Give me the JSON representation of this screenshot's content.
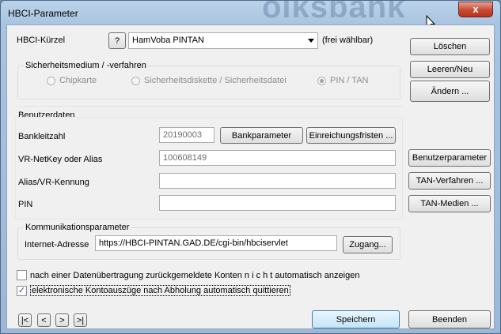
{
  "window": {
    "title": "HBCI-Parameter",
    "watermark": "olksbank",
    "close_glyph": "x"
  },
  "hbci_kuerzel": {
    "label": "HBCI-Kürzel",
    "help_label": "?",
    "value": "HamVoba PINTAN",
    "hint": "(frei wählbar)"
  },
  "security": {
    "title": "Sicherheitsmedium / -verfahren",
    "options": [
      "Chipkarte",
      "Sicherheitsdiskette / Sicherheitsdatei",
      "PIN / TAN"
    ],
    "selected": "PIN / TAN"
  },
  "user_data": {
    "title": "Benutzerdaten",
    "bankleitzahl_label": "Bankleitzahl",
    "bankleitzahl_value": "20190003",
    "bankparameter_button": "Bankparameter",
    "einreichungsfristen_button": "Einreichungsfristen ...",
    "netkey_label": "VR-NetKey oder Alias",
    "netkey_value": "100608149",
    "alias_label": "Alias/VR-Kennung",
    "alias_value": "",
    "pin_label": "PIN",
    "pin_value": ""
  },
  "communication": {
    "title": "Kommunikationsparameter",
    "address_label": "Internet-Adresse",
    "address_value": "https://HBCI-PINTAN.GAD.DE/cgi-bin/hbciservlet",
    "zugang_button": "Zugang..."
  },
  "options": {
    "unreported_accounts_label": "nach einer Datenübertragung zurückgemeldete Konten  n i c h t  automatisch anzeigen",
    "unreported_accounts_checked": false,
    "statements_label": "elektronische Kontoauszüge nach Abholung automatisch quittieren",
    "statements_checked": true,
    "check_glyph": "✓"
  },
  "side_buttons": {
    "loeschen": "Löschen",
    "leeren_neu": "Leeren/Neu",
    "aendern": "Ändern ...",
    "benutzerparameter": "Benutzerparameter",
    "tan_verfahren": "TAN-Verfahren ...",
    "tan_medien": "TAN-Medien ..."
  },
  "nav": {
    "first": "|<",
    "prev": "<",
    "next": ">",
    "last": ">|"
  },
  "footer": {
    "speichern": "Speichern",
    "beenden": "Beenden"
  }
}
